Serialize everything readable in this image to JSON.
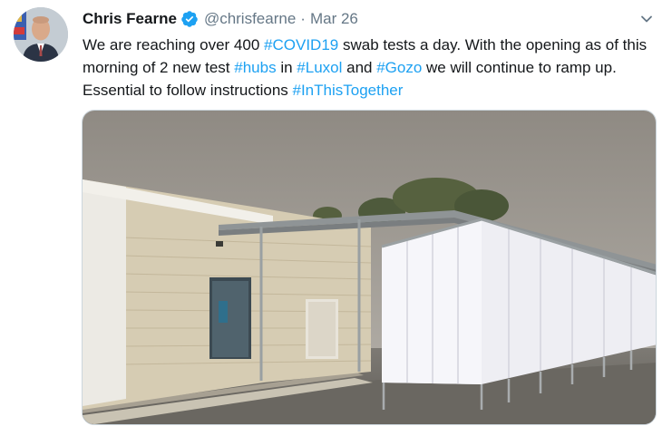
{
  "author": {
    "name": "Chris Fearne",
    "handle": "@chrisfearne",
    "separator": "·",
    "date": "Mar 26"
  },
  "tweet": {
    "t1": "We are reaching over 400 ",
    "h1": "#COVID19",
    "t2": " swab tests a day. With the opening as of this morning of 2 new test ",
    "h2": "#hubs",
    "t3": " in ",
    "h3": "#Luxol",
    "t4": " and ",
    "h4": "#Gozo",
    "t5": " we will continue to ramp up. Essential to follow instructions ",
    "h5": "#InThisTogether"
  },
  "colors": {
    "link": "#1da1f2",
    "secondary_text": "#657786",
    "verified_badge": "#1da1f2"
  },
  "icons": {
    "verified": "verified-badge-icon",
    "menu": "chevron-down-icon"
  }
}
